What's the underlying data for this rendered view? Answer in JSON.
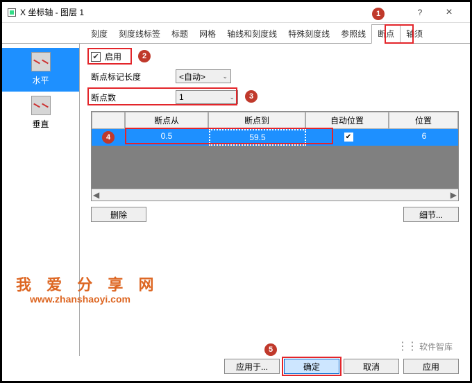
{
  "window": {
    "title": "X 坐标轴 - 图层 1",
    "help": "?",
    "close": "×"
  },
  "tabs": [
    "刻度",
    "刻度线标签",
    "标题",
    "网格",
    "轴线和刻度线",
    "特殊刻度线",
    "参照线",
    "断点",
    "轴须"
  ],
  "active_tab": "断点",
  "sidebar": {
    "items": [
      {
        "label": "水平"
      },
      {
        "label": "垂直"
      }
    ]
  },
  "enable": {
    "label": "启用",
    "checked": "✔"
  },
  "marker_len": {
    "label": "断点标记长度",
    "value": "<自动>"
  },
  "count": {
    "label": "断点数",
    "value": "1"
  },
  "table": {
    "headers": [
      "",
      "断点从",
      "断点到",
      "自动位置",
      "位置"
    ],
    "row": {
      "from": "0.5",
      "to": "59.5",
      "auto": "✔",
      "pos": "6"
    }
  },
  "buttons": {
    "delete": "删除",
    "detail": "细节...",
    "apply_to": "应用于...",
    "ok": "确定",
    "cancel": "取消",
    "apply": "应用"
  },
  "badges": {
    "b1": "1",
    "b2": "2",
    "b3": "3",
    "b4": "4",
    "b5": "5"
  },
  "watermark": {
    "line1": "我 爱 分 享 网",
    "line2": "www.zhanshaoyi.com",
    "brand": "软件智库"
  },
  "scroll": {
    "left": "◀",
    "right": "▶"
  }
}
